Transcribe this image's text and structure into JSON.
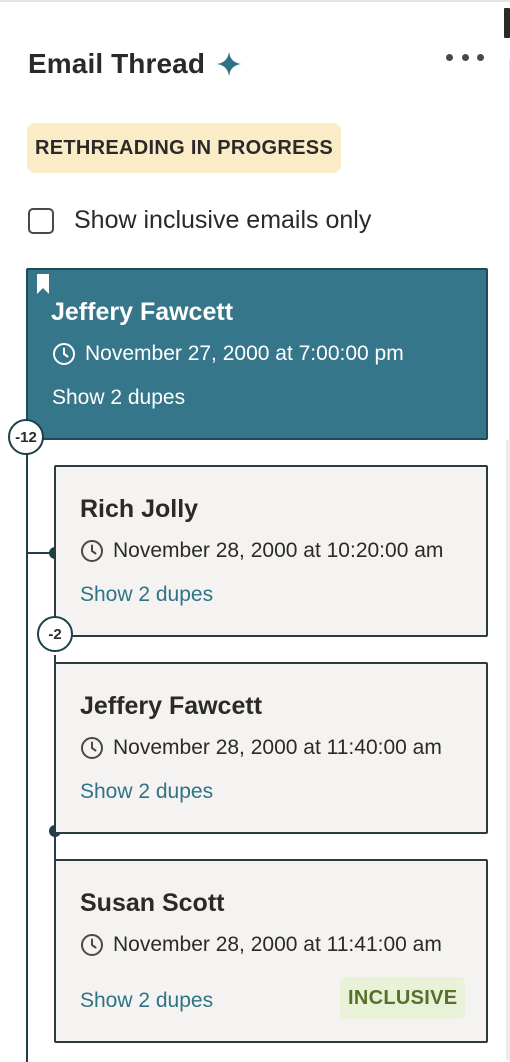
{
  "header": {
    "title": "Email Thread",
    "sparkle_icon": "sparkle-icon",
    "more_icon": "more-horizontal-icon"
  },
  "status_badge": "RETHREADING IN PROGRESS",
  "filter": {
    "label": "Show inclusive emails only",
    "checked": false
  },
  "thread": {
    "root": {
      "sender": "Jeffery Fawcett",
      "date": "November 27, 2000 at 7:00:00 pm",
      "dupes": "Show 2 dupes",
      "count": "-12",
      "bookmarked": true
    },
    "emails": [
      {
        "sender": "Rich Jolly",
        "date": "November 28, 2000 at 10:20:00 am",
        "dupes": "Show 2 dupes",
        "count": "-2"
      },
      {
        "sender": "Jeffery Fawcett",
        "date": "November 28, 2000 at 11:40:00 am",
        "dupes": "Show 2 dupes"
      },
      {
        "sender": "Susan Scott",
        "date": "November 28, 2000 at 11:41:00 am",
        "dupes": "Show 2 dupes",
        "badge": "INCLUSIVE"
      }
    ]
  },
  "colors": {
    "selected_card": "#36768a",
    "link": "#2f7387",
    "status_badge_bg": "#fbecc8",
    "inclusive_badge_bg": "#e9f2d8",
    "inclusive_badge_text": "#57712b"
  }
}
